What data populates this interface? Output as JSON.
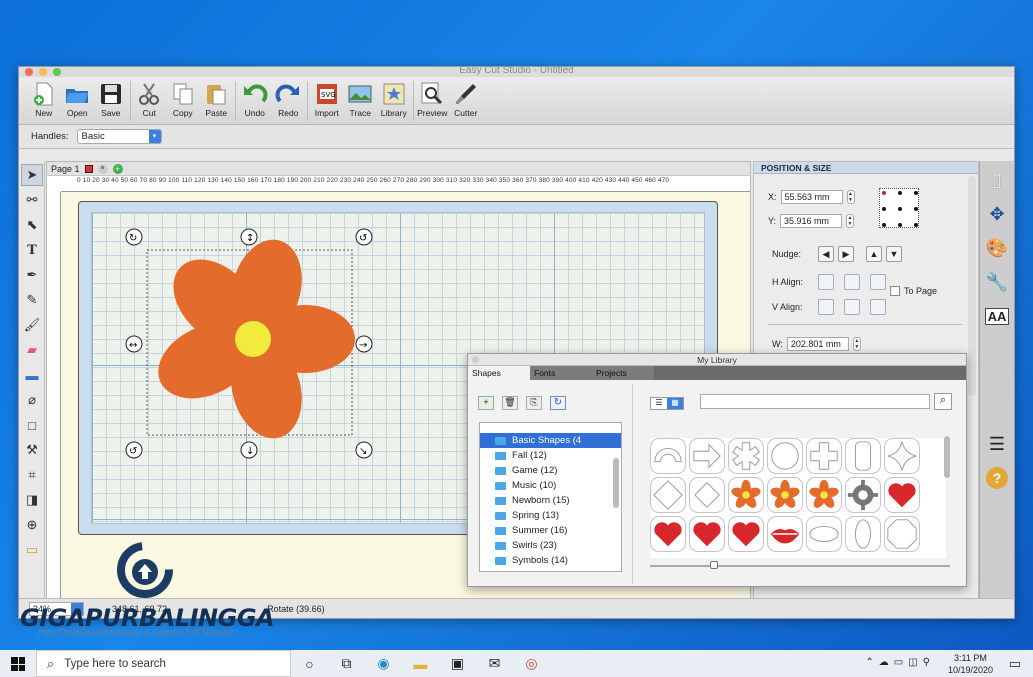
{
  "window": {
    "title": "Easy Cut Studio - Untitled"
  },
  "toolbar": {
    "buttons": [
      {
        "label": "New",
        "icon": "new-document-icon"
      },
      {
        "label": "Open",
        "icon": "open-folder-icon"
      },
      {
        "label": "Save",
        "icon": "floppy-disk-icon"
      },
      {
        "label": "Cut",
        "icon": "scissors-icon"
      },
      {
        "label": "Copy",
        "icon": "copy-icon"
      },
      {
        "label": "Paste",
        "icon": "paste-icon"
      },
      {
        "label": "Undo",
        "icon": "undo-arrow-icon"
      },
      {
        "label": "Redo",
        "icon": "redo-arrow-icon"
      },
      {
        "label": "Import",
        "icon": "import-svg-icon"
      },
      {
        "label": "Trace",
        "icon": "trace-image-icon"
      },
      {
        "label": "Library",
        "icon": "library-star-icon"
      },
      {
        "label": "Preview",
        "icon": "magnifier-icon"
      },
      {
        "label": "Cutter",
        "icon": "cutter-blade-icon"
      }
    ]
  },
  "options": {
    "handles_label": "Handles:",
    "handles_value": "Basic"
  },
  "canvas": {
    "page_tab": "Page 1",
    "ruler_text": "0 10 20 30 40 50 60 70 80 90 100 110 120 130 140 150 160 170 180 190 200 210 220 230 240 250 260 270 280 290 300 310 320 330 340 350 360 370 380 390 400 410 420 430 440 450 460 470",
    "flower_color": "#e36b2c",
    "flower_center_color": "#f2ea3c"
  },
  "status": {
    "zoom": "34%",
    "coords": "348.61, 69.72",
    "message": "Rotate (39.66)"
  },
  "position_panel": {
    "header": "POSITION & SIZE",
    "x_label": "X:",
    "x_value": "55.563 mm",
    "y_label": "Y:",
    "y_value": "35.916 mm",
    "nudge_label": "Nudge:",
    "halign_label": "H Align:",
    "valign_label": "V Align:",
    "to_page_label": "To Page",
    "w_label": "W:",
    "w_value": "202.801 mm"
  },
  "library": {
    "title": "My Library",
    "tabs": [
      "Shapes",
      "Fonts",
      "Projects"
    ],
    "categories": [
      "Basic Shapes (4",
      "Fall (12)",
      "Game (12)",
      "Music (10)",
      "Newborn (15)",
      "Spring (13)",
      "Summer (16)",
      "Swirls (23)",
      "Symbols (14)"
    ],
    "search_placeholder": ""
  },
  "watermark": {
    "brand": "GIGAPURBALINGGA",
    "tagline": "Free Download Software & Games Full Version"
  },
  "taskbar": {
    "search_placeholder": "Type here to search",
    "time": "3:11 PM",
    "date": "10/19/2020"
  }
}
